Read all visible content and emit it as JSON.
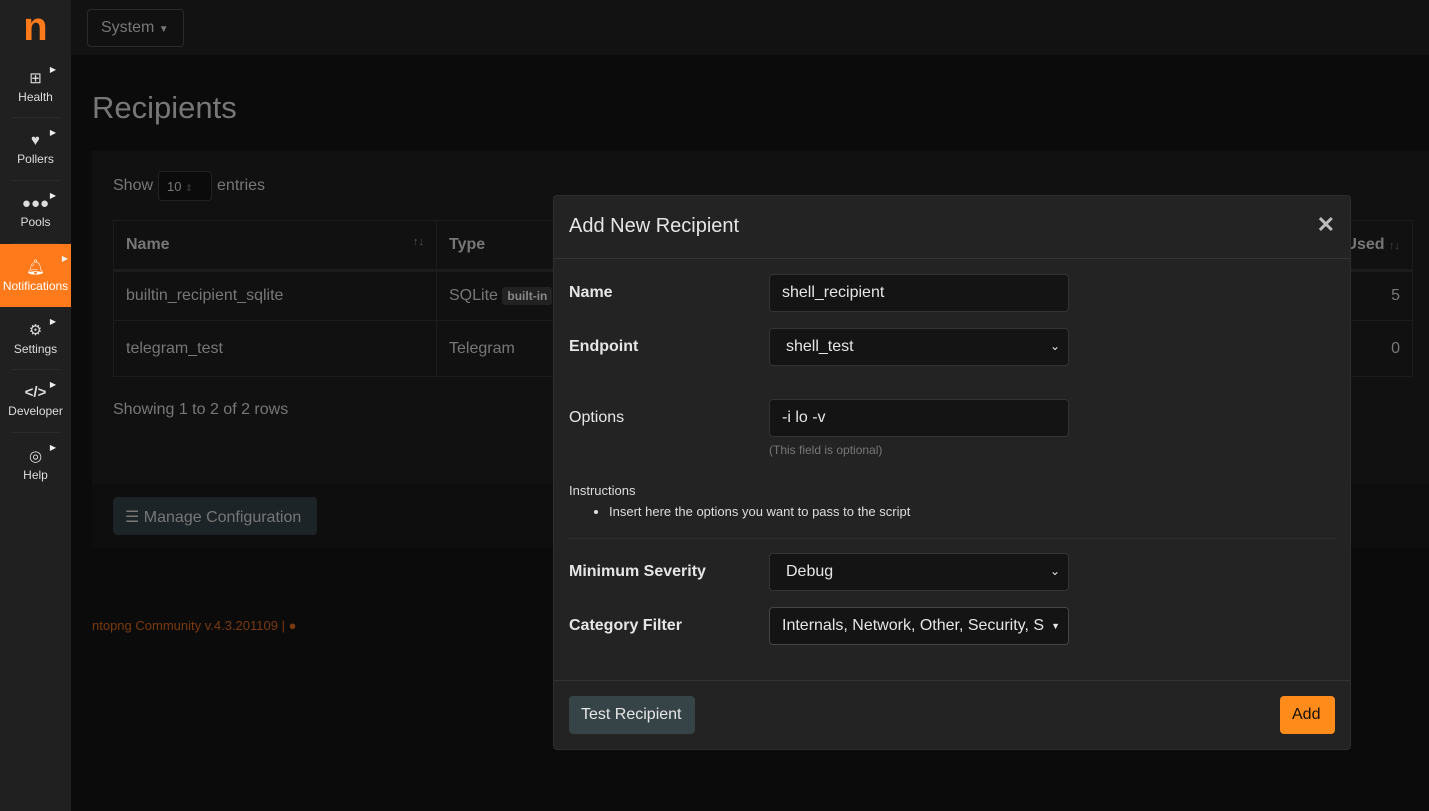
{
  "sidebar": {
    "logo": "n",
    "items": [
      {
        "label": "Health",
        "icon": "laptop-medical-icon"
      },
      {
        "label": "Pollers",
        "icon": "heartbeat-icon"
      },
      {
        "label": "Pools",
        "icon": "users-icon"
      },
      {
        "label": "Notifications",
        "icon": "bell-icon",
        "active": true
      },
      {
        "label": "Settings",
        "icon": "gear-icon"
      },
      {
        "label": "Developer",
        "icon": "code-icon"
      },
      {
        "label": "Help",
        "icon": "life-ring-icon"
      }
    ]
  },
  "topbar": {
    "system_label": "System"
  },
  "page": {
    "title": "Recipients"
  },
  "table": {
    "show_label": "Show",
    "entries_value": "10",
    "entries_label": "entries",
    "columns": [
      "Name",
      "Type",
      "s Used"
    ],
    "rows": [
      {
        "name": "builtin_recipient_sqlite",
        "type": "SQLite",
        "badge": "built-in",
        "used": "5"
      },
      {
        "name": "telegram_test",
        "type": "Telegram",
        "used": "0"
      }
    ],
    "showing": "Showing 1 to 2 of 2 rows"
  },
  "manage_label": "Manage Configuration",
  "footer": {
    "text": "ntopng Community v.4.3.201109 |"
  },
  "modal": {
    "title": "Add New Recipient",
    "name_label": "Name",
    "name_value": "shell_recipient",
    "endpoint_label": "Endpoint",
    "endpoint_value": "shell_test",
    "options_label": "Options",
    "options_value": "-i lo -v",
    "options_hint": "(This field is optional)",
    "instructions_title": "Instructions",
    "instructions": [
      "Insert here the options you want to pass to the script"
    ],
    "severity_label": "Minimum Severity",
    "severity_value": "Debug",
    "category_label": "Category Filter",
    "category_value": "Internals, Network, Other, Security, S",
    "test_label": "Test Recipient",
    "add_label": "Add"
  },
  "colors": {
    "accent": "#ff7a1a"
  }
}
